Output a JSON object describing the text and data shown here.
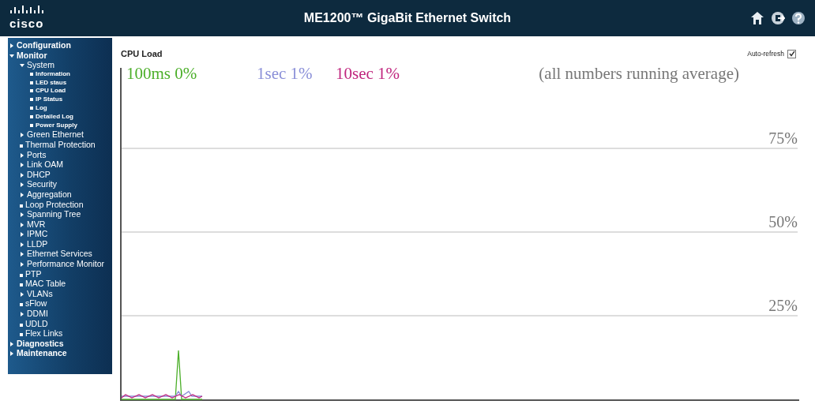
{
  "header": {
    "logo": "cisco",
    "title": "ME1200™ GigaBit Ethernet Switch"
  },
  "sidebar": {
    "items": [
      {
        "label": "Configuration",
        "kind": "folder",
        "expanded": false
      },
      {
        "label": "Monitor",
        "kind": "folder",
        "expanded": true,
        "children": [
          {
            "label": "System",
            "kind": "folder",
            "expanded": true,
            "children": [
              {
                "label": "Information",
                "kind": "leaf"
              },
              {
                "label": "LED staus",
                "kind": "leaf"
              },
              {
                "label": "CPU Load",
                "kind": "leaf"
              },
              {
                "label": "IP Status",
                "kind": "leaf"
              },
              {
                "label": "Log",
                "kind": "leaf"
              },
              {
                "label": "Detailed Log",
                "kind": "leaf"
              },
              {
                "label": "Power Supply",
                "kind": "leaf"
              }
            ]
          },
          {
            "label": "Green Ethernet",
            "kind": "folder",
            "expanded": false
          },
          {
            "label": "Thermal Protection",
            "kind": "leaf"
          },
          {
            "label": "Ports",
            "kind": "folder",
            "expanded": false
          },
          {
            "label": "Link OAM",
            "kind": "folder",
            "expanded": false
          },
          {
            "label": "DHCP",
            "kind": "folder",
            "expanded": false
          },
          {
            "label": "Security",
            "kind": "folder",
            "expanded": false
          },
          {
            "label": "Aggregation",
            "kind": "folder",
            "expanded": false
          },
          {
            "label": "Loop Protection",
            "kind": "leaf"
          },
          {
            "label": "Spanning Tree",
            "kind": "folder",
            "expanded": false
          },
          {
            "label": "MVR",
            "kind": "folder",
            "expanded": false
          },
          {
            "label": "IPMC",
            "kind": "folder",
            "expanded": false
          },
          {
            "label": "LLDP",
            "kind": "folder",
            "expanded": false
          },
          {
            "label": "Ethernet Services",
            "kind": "folder",
            "expanded": false
          },
          {
            "label": "Performance Monitor",
            "kind": "folder",
            "expanded": false
          },
          {
            "label": "PTP",
            "kind": "leaf"
          },
          {
            "label": "MAC Table",
            "kind": "leaf"
          },
          {
            "label": "VLANs",
            "kind": "folder",
            "expanded": false
          },
          {
            "label": "sFlow",
            "kind": "leaf"
          },
          {
            "label": "DDMI",
            "kind": "folder",
            "expanded": false
          },
          {
            "label": "UDLD",
            "kind": "leaf"
          },
          {
            "label": "Flex Links",
            "kind": "leaf"
          }
        ]
      },
      {
        "label": "Diagnostics",
        "kind": "folder",
        "expanded": false
      },
      {
        "label": "Maintenance",
        "kind": "folder",
        "expanded": false
      }
    ]
  },
  "page": {
    "title": "CPU Load",
    "auto_refresh": {
      "label": "Auto-refresh",
      "checked": true
    }
  },
  "graph": {
    "legend": [
      {
        "label": "100ms 0%",
        "color": "#4caf2a"
      },
      {
        "label": "1sec 1%",
        "color": "#8a8fd8"
      },
      {
        "label": "10sec 1%",
        "color": "#c0267e"
      }
    ],
    "note": "(all numbers running average)",
    "gridlines": [
      {
        "label": "75%"
      },
      {
        "label": "50%"
      },
      {
        "label": "25%"
      }
    ]
  }
}
